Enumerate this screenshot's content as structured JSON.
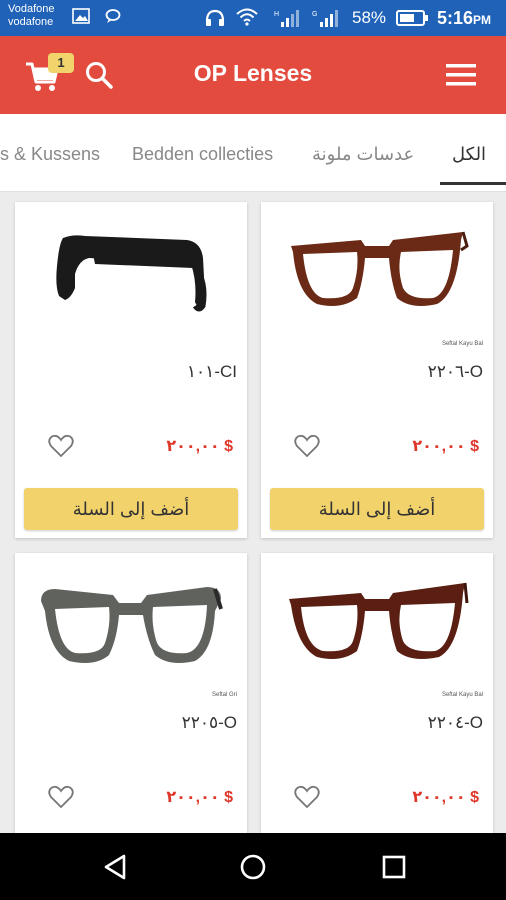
{
  "status_bar": {
    "carrier_line1": "Vodafone",
    "carrier_line2": "vodafone",
    "battery_percent": "58%",
    "time": "5:16",
    "time_suffix": "PM"
  },
  "app_bar": {
    "title": "OP Lenses",
    "cart_count": "1",
    "colors": {
      "background": "#e34b3e",
      "badge": "#f2d46d"
    }
  },
  "tabs": [
    {
      "label": "الكل",
      "active": true
    },
    {
      "label": "عدسات ملونة",
      "active": false
    },
    {
      "label": "Bedden collecties",
      "active": false
    },
    {
      "label": "s & Kussens",
      "active": false
    }
  ],
  "products": [
    {
      "name": "O-٢٢٠٦",
      "brand": "Seftal Kayu Bal",
      "price": "$ ٢٠٠,٠٠",
      "add_label": "أضف إلى السلة",
      "image_icon": "brown-glasses-icon"
    },
    {
      "name": "CI-١٠١",
      "brand": "",
      "price": "$ ٢٠٠,٠٠",
      "add_label": "أضف إلى السلة",
      "image_icon": "black-glasses-side-icon"
    },
    {
      "name": "O-٢٢٠٤",
      "brand": "Seftal Kayu Bal",
      "price": "$ ٢٠٠,٠٠",
      "add_label": "",
      "image_icon": "brown-glasses-icon"
    },
    {
      "name": "O-٢٢٠٥",
      "brand": "Seftal Gri",
      "price": "$ ٢٠٠,٠٠",
      "add_label": "",
      "image_icon": "grey-glasses-icon"
    }
  ],
  "colors": {
    "price": "#e0372b",
    "add_button": "#f2d36b",
    "status_bar": "#1f62b8"
  },
  "nav_bar": {
    "icons": [
      "back-icon",
      "home-icon",
      "recents-icon"
    ]
  }
}
